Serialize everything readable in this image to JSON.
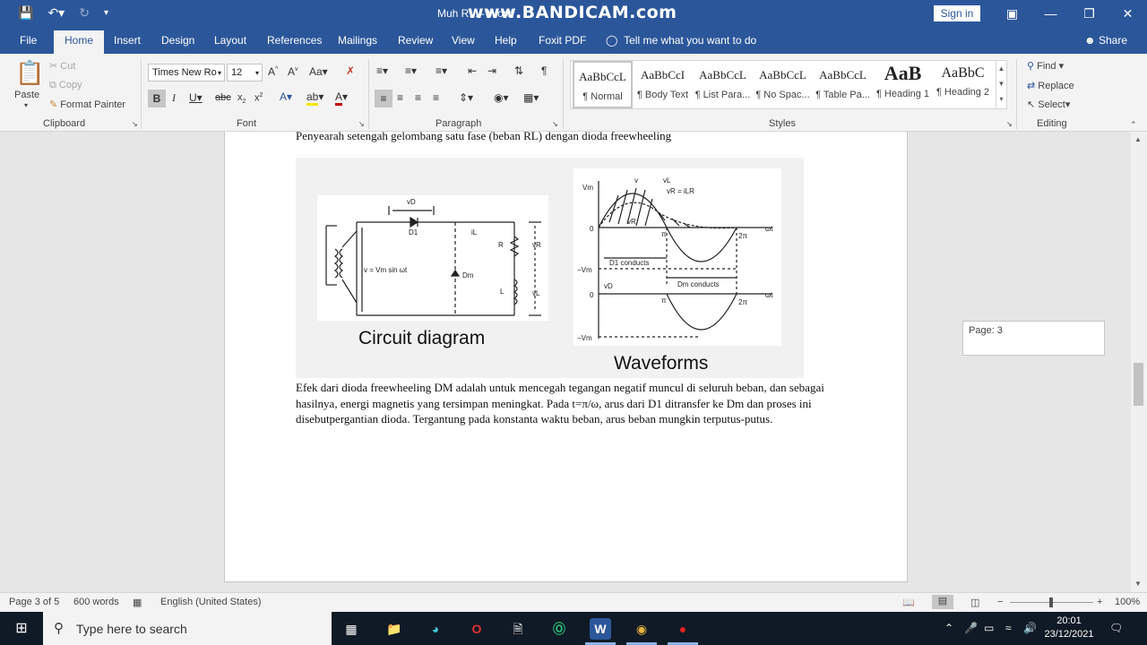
{
  "window": {
    "title": "Muh R... - Word",
    "watermark": "www.BANDICAM.com",
    "sign_in": "Sign in"
  },
  "tabs": [
    "File",
    "Home",
    "Insert",
    "Design",
    "Layout",
    "References",
    "Mailings",
    "Review",
    "View",
    "Help",
    "Foxit PDF"
  ],
  "tell_me": "Tell me what you want to do",
  "share": "Share",
  "clipboard": {
    "paste": "Paste",
    "cut": "Cut",
    "copy": "Copy",
    "format_painter": "Format Painter",
    "label": "Clipboard"
  },
  "font": {
    "name": "Times New Ro",
    "size": "12",
    "label": "Font"
  },
  "paragraph": {
    "label": "Paragraph"
  },
  "styles": {
    "label": "Styles",
    "items": [
      {
        "preview": "AaBbCcL",
        "name": "¶ Normal"
      },
      {
        "preview": "AaBbCcI",
        "name": "¶ Body Text"
      },
      {
        "preview": "AaBbCcL",
        "name": "¶ List Para..."
      },
      {
        "preview": "AaBbCcL",
        "name": "¶ No Spac..."
      },
      {
        "preview": "AaBbCcL",
        "name": "¶ Table Pa..."
      },
      {
        "preview": "AaB",
        "name": "¶ Heading 1"
      },
      {
        "preview": "AaBbC",
        "name": "¶ Heading 2"
      }
    ]
  },
  "editing": {
    "find": "Find",
    "replace": "Replace",
    "select": "Select",
    "label": "Editing"
  },
  "document": {
    "heading_line": "Penyearah setengah gelombang satu fase (beban RL) dengan dioda freewheeling",
    "caption_circuit": "Circuit diagram",
    "caption_waveforms": "Waveforms",
    "circuit_labels": {
      "vd": "vD",
      "d1": "D1",
      "il": "iL",
      "r": "R",
      "l": "L",
      "vr": "vR",
      "vl": "vL",
      "source": "v = Vm sin ωt",
      "dm": "Dm"
    },
    "wave_labels": {
      "vm": "Vm",
      "v": "v",
      "vl": "vL",
      "vr_eq": "vR = iLR",
      "vr": "vR",
      "zero": "0",
      "pi": "π",
      "two_pi": "2π",
      "wt": "ωt",
      "neg_vm": "−Vm",
      "d1_conducts": "D1 conducts",
      "vd": "vD",
      "dm_conducts": "Dm conducts"
    },
    "paragraph": "Efek dari dioda freewheeling DM adalah untuk mencegah tegangan negatif muncul di seluruh beban, dan sebagai hasilnya, energi magnetis yang tersimpan meningkat. Pada t=π/ω, arus dari D1 ditransfer ke Dm dan proses ini disebutpergantian dioda. Tergantung pada konstanta waktu beban, arus beban mungkin terputus-putus."
  },
  "nav_pane": {
    "page_label": "Page: 3"
  },
  "status": {
    "page": "Page 3 of 5",
    "words": "600 words",
    "language": "English (United States)",
    "zoom": "100%"
  },
  "taskbar": {
    "search_placeholder": "Type here to search",
    "time": "20:01",
    "date": "23/12/2021"
  }
}
